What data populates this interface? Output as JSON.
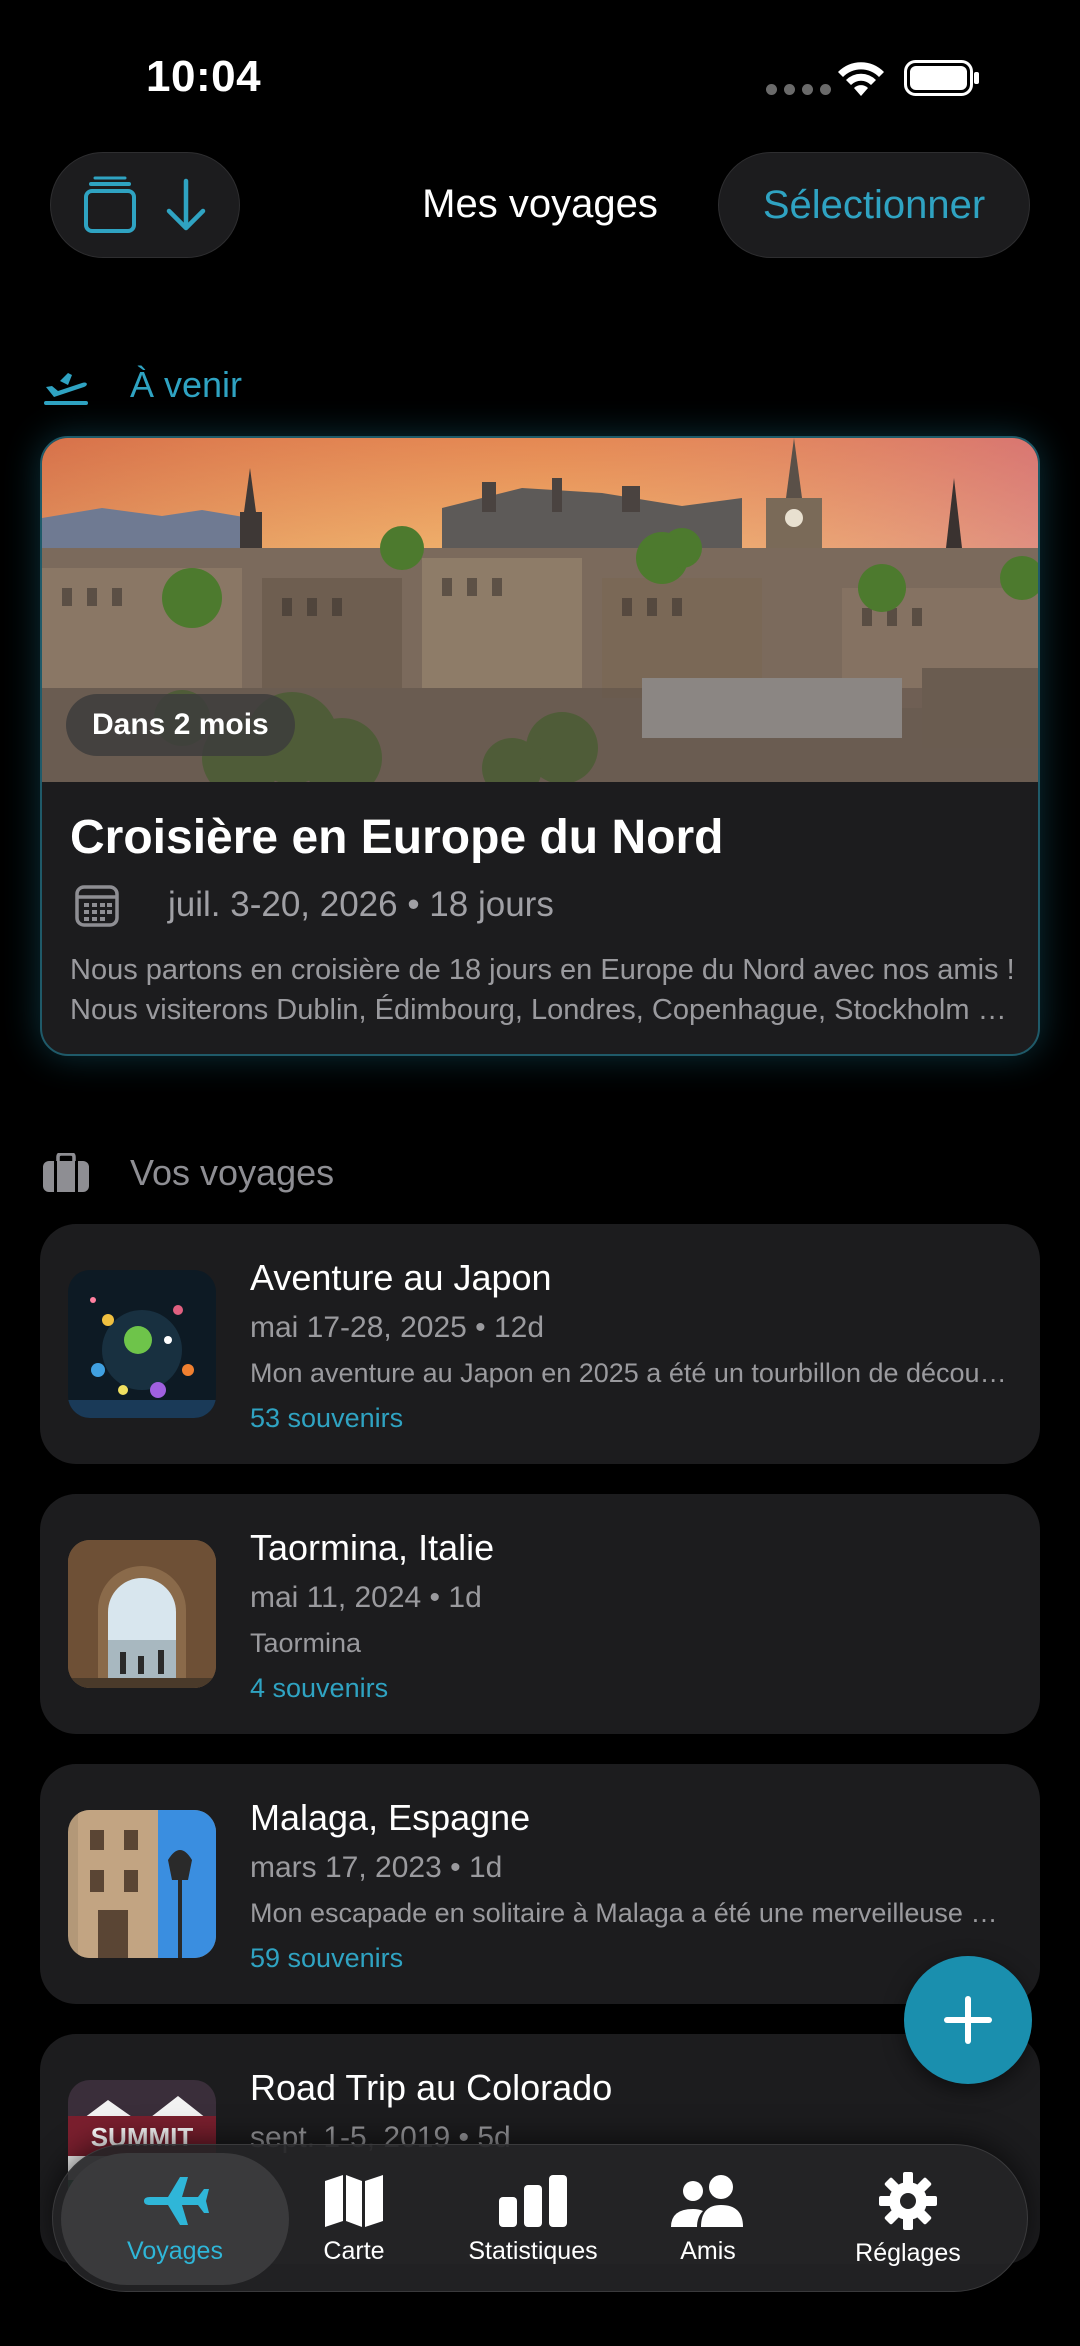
{
  "status_bar": {
    "time": "10:04"
  },
  "header": {
    "title": "Mes voyages",
    "select_label": "Sélectionner",
    "left_icons": [
      "stack-icon",
      "sort-down-icon"
    ]
  },
  "upcoming": {
    "section_label": "À venir",
    "badge": "Dans 2 mois",
    "title": "Croisière en Europe du Nord",
    "dates": "juil. 3-20, 2026 • 18 jours",
    "description": "Nous partons en croisière de 18 jours en Europe du Nord avec nos amis ! Nous visiterons Dublin, Édimbourg, Londres, Copenhague, Stockholm et bien d'autres villes."
  },
  "trips_section": {
    "label": "Vos voyages"
  },
  "trips": [
    {
      "name": "Aventure au Japon",
      "meta": "mai 17-28, 2025 • 12d",
      "snippet": "Mon aventure au Japon en 2025 a été un tourbillon de découvertes",
      "memories": "53 souvenirs"
    },
    {
      "name": "Taormina, Italie",
      "meta": "mai 11, 2024 • 1d",
      "snippet": "Taormina",
      "memories": "4 souvenirs"
    },
    {
      "name": "Malaga, Espagne",
      "meta": "mars 17, 2023 • 1d",
      "snippet": "Mon escapade en solitaire à Malaga a été une merveilleuse expérience",
      "memories": "59 souvenirs"
    },
    {
      "name": "Road Trip au Colorado",
      "meta": "sept. 1-5, 2019 • 5d",
      "snippet": "",
      "memories": "",
      "thumb_text": "SUMMIT"
    }
  ],
  "tabs": [
    {
      "label": "Voyages",
      "icon": "airplane-icon",
      "active": true
    },
    {
      "label": "Carte",
      "icon": "map-icon",
      "active": false
    },
    {
      "label": "Statistiques",
      "icon": "bar-chart-icon",
      "active": false
    },
    {
      "label": "Amis",
      "icon": "people-icon",
      "active": false
    },
    {
      "label": "Réglages",
      "icon": "gear-icon",
      "active": false
    }
  ],
  "colors": {
    "accent": "#2fa3c2",
    "fab": "#1a8fae",
    "card": "#1c1c1e",
    "background": "#000000"
  }
}
